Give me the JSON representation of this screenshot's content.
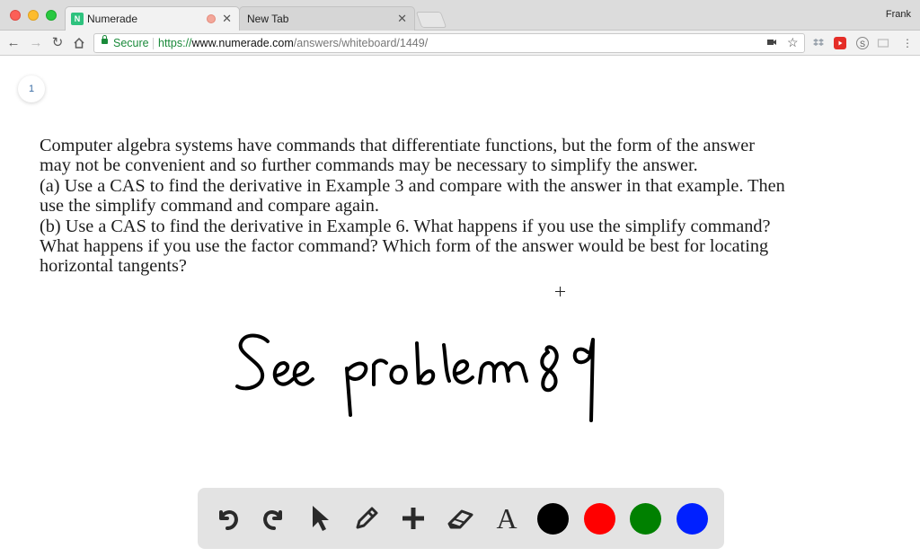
{
  "browser": {
    "user_name": "Frank",
    "tabs": [
      {
        "title": "Numerade",
        "favicon_letter": "N",
        "active": true
      },
      {
        "title": "New Tab",
        "active": false
      }
    ],
    "address_bar": {
      "security_label": "Secure",
      "url_scheme": "https://",
      "url_host": "www.numerade.com",
      "url_path": "/answers/whiteboard/1449/"
    },
    "extension_icons": [
      "camera-icon",
      "star-icon",
      "dropbox-icon",
      "youtube-icon",
      "s-icon",
      "cast-icon",
      "menu-icon"
    ]
  },
  "whiteboard": {
    "page_number": "1",
    "question_lines": [
      "Computer algebra systems have commands that differentiate functions, but the form of the answer",
      "may not be convenient and so further commands may be necessary to simplify the answer.",
      "(a) Use a CAS to find the derivative in Example 3 and compare with the answer in that example. Then",
      "use the simplify command and compare again.",
      "(b) Use a CAS to find the derivative in Example 6. What happens if you use the simplify command?",
      "What happens if you use the factor command? Which form of the answer would be best for locating",
      "horizontal tangents?"
    ],
    "handwritten_note": "See problem 89"
  },
  "toolbar": {
    "tools": [
      "undo-icon",
      "redo-icon",
      "pointer-icon",
      "pen-icon",
      "add-icon",
      "eraser-icon",
      "text-icon"
    ],
    "text_tool_glyph": "A",
    "colors": [
      "#000000",
      "#ff0000",
      "#008000",
      "#0020ff"
    ]
  }
}
